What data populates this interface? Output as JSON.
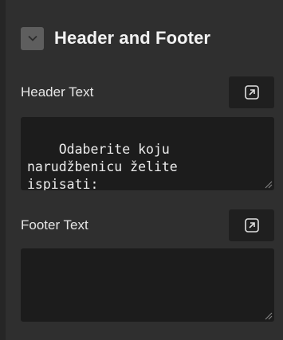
{
  "section": {
    "title": "Header and Footer",
    "toggle_icon": "chevron-down-icon"
  },
  "header_text": {
    "label": "Header Text",
    "value": "Odaberite koju\nnarudžbenicu želite\nispisati:",
    "expand_icon": "expand-arrow-icon"
  },
  "footer_text": {
    "label": "Footer Text",
    "value": "",
    "expand_icon": "expand-arrow-icon"
  },
  "colors": {
    "panel_bg": "#2f2f2f",
    "field_bg": "#1c1c1c",
    "text": "#f2f2f2"
  }
}
